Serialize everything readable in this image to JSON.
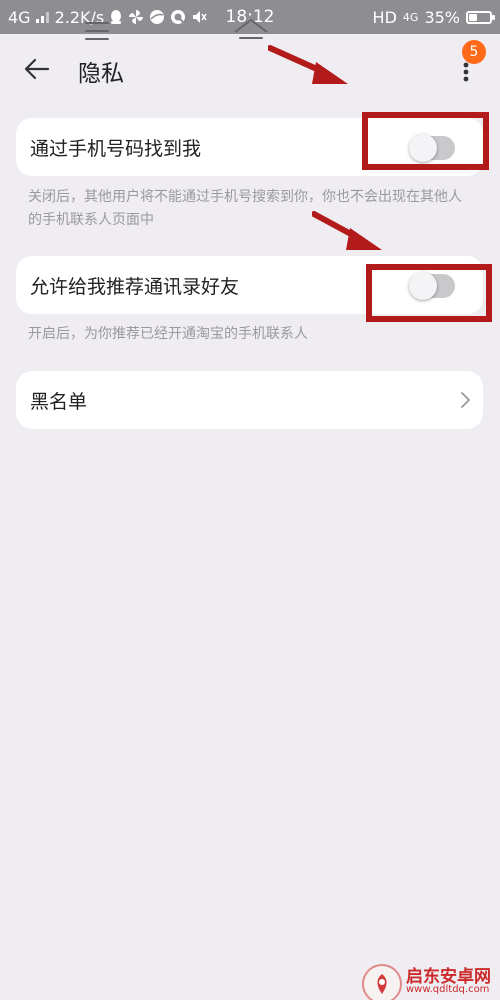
{
  "status_bar": {
    "network": "4G",
    "speed": "2.2K/s",
    "time": "18:12",
    "hd": "HD",
    "network_right": "4G",
    "battery": "35%"
  },
  "header": {
    "title": "隐私",
    "badge_count": "5"
  },
  "settings": [
    {
      "label": "通过手机号码找到我",
      "enabled": false,
      "description": "关闭后，其他用户将不能通过手机号搜索到你，你也不会出现在其他人的手机联系人页面中"
    },
    {
      "label": "允许给我推荐通讯录好友",
      "enabled": false,
      "description": "开启后，为你推荐已经开通淘宝的手机联系人"
    }
  ],
  "blacklist": {
    "label": "黑名单"
  },
  "watermark": {
    "title": "启东安卓网",
    "url": "www.qdltdq.com"
  },
  "colors": {
    "background": "#efedf2",
    "annotation": "#b31a1a",
    "badge": "#ff6a1a",
    "toggle_off": "#c9c9cc"
  }
}
